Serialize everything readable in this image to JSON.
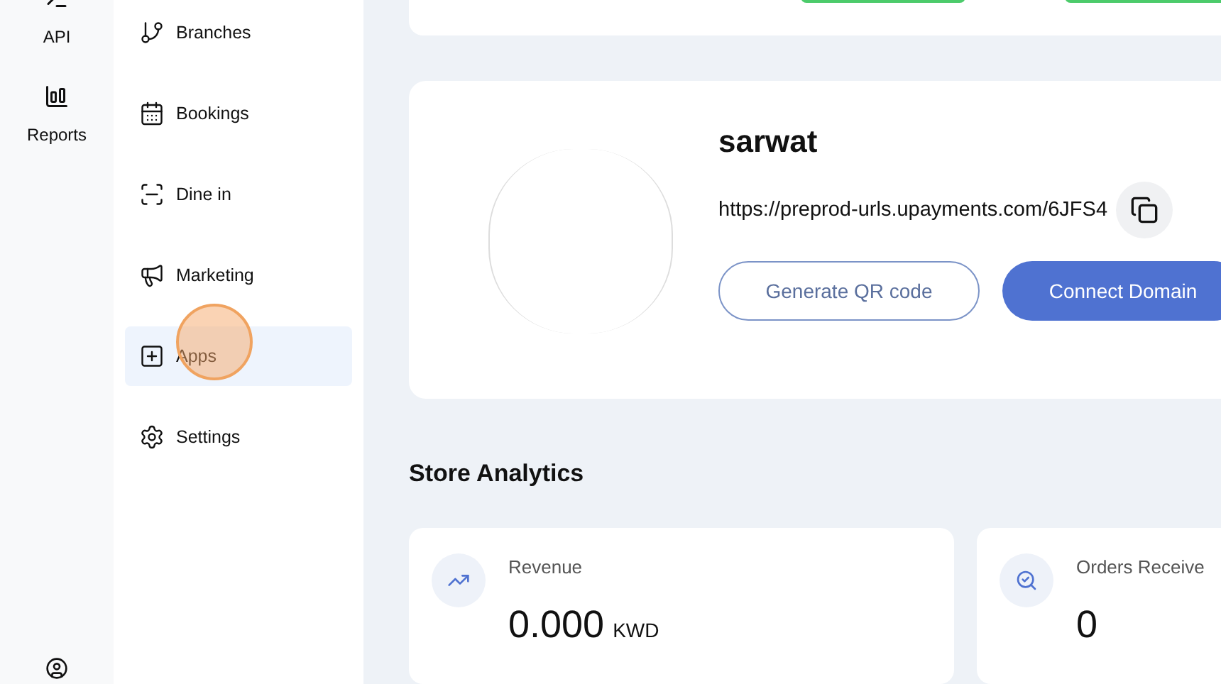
{
  "rail": {
    "items": [
      {
        "label": "API",
        "kind": "api"
      },
      {
        "label": "Reports",
        "kind": "reports"
      }
    ]
  },
  "sidebar": {
    "items": [
      {
        "label": "Branches",
        "kind": "branch",
        "selected": false
      },
      {
        "label": "Bookings",
        "kind": "calendar",
        "selected": false
      },
      {
        "label": "Dine in",
        "kind": "scan",
        "selected": false
      },
      {
        "label": "Marketing",
        "kind": "megaphone",
        "selected": false
      },
      {
        "label": "Apps",
        "kind": "apps",
        "selected": true
      },
      {
        "label": "Settings",
        "kind": "gear",
        "selected": false
      }
    ]
  },
  "store": {
    "name": "sarwat",
    "url": "https://preprod-urls.upayments.com/6JFS4",
    "buttons": [
      {
        "label": "Generate QR code",
        "kind": "outline"
      },
      {
        "label": "Connect Domain",
        "kind": "primary"
      }
    ]
  },
  "analytics": {
    "title": "Store Analytics",
    "cards": [
      {
        "label": "Revenue",
        "value": "0.000",
        "unit": "KWD",
        "kind": "trend"
      },
      {
        "label": "Orders Receive",
        "value": "0",
        "kind": "search"
      }
    ]
  }
}
